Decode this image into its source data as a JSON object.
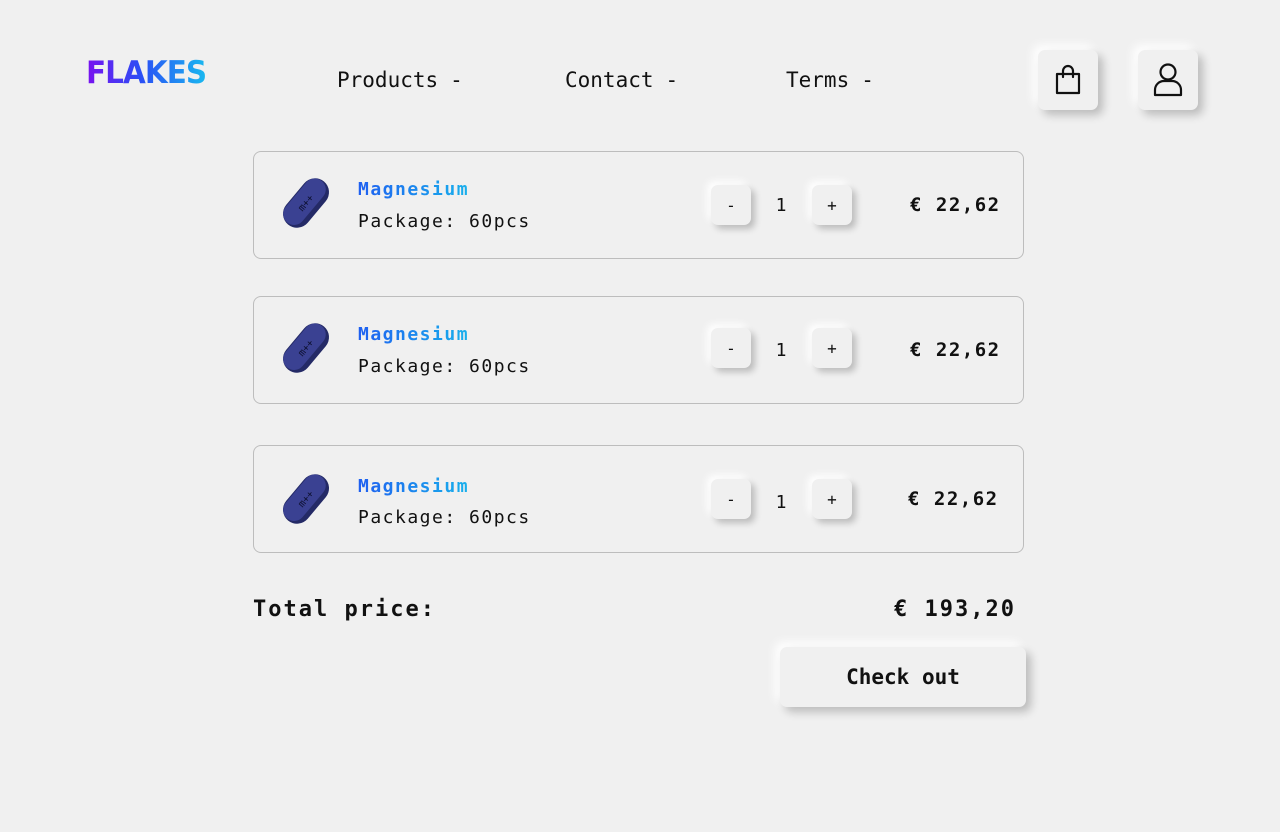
{
  "brand": {
    "logo": "FLAKES"
  },
  "nav": [
    {
      "label": "Products",
      "caret": "-"
    },
    {
      "label": "Contact",
      "caret": "-"
    },
    {
      "label": "Terms",
      "caret": "-"
    }
  ],
  "header_icons": [
    "shopping-bag-icon",
    "user-icon"
  ],
  "cart": {
    "items": [
      {
        "name": "Magnesium",
        "package": "Package: 60pcs",
        "quantity": "1",
        "minus": "-",
        "plus": "+",
        "price": "€ 22,62",
        "image_label": "m++"
      },
      {
        "name": "Magnesium",
        "package": "Package: 60pcs",
        "quantity": "1",
        "minus": "-",
        "plus": "+",
        "price": "€ 22,62",
        "image_label": "m++"
      },
      {
        "name": "Magnesium",
        "package": "Package: 60pcs",
        "quantity": "1",
        "minus": "-",
        "plus": "+",
        "price": "€ 22,62",
        "image_label": "m++"
      }
    ],
    "total_label": "Total price:",
    "total_value": "€ 193,20",
    "checkout_label": "Check out"
  },
  "colors": {
    "background": "#f0f0f0",
    "logo_gradient_start": "#7a10f0",
    "logo_gradient_end": "#19b8f0",
    "product_name_start": "#1f5ff0",
    "product_name_end": "#18b0ec",
    "pill": "#2f3478"
  }
}
